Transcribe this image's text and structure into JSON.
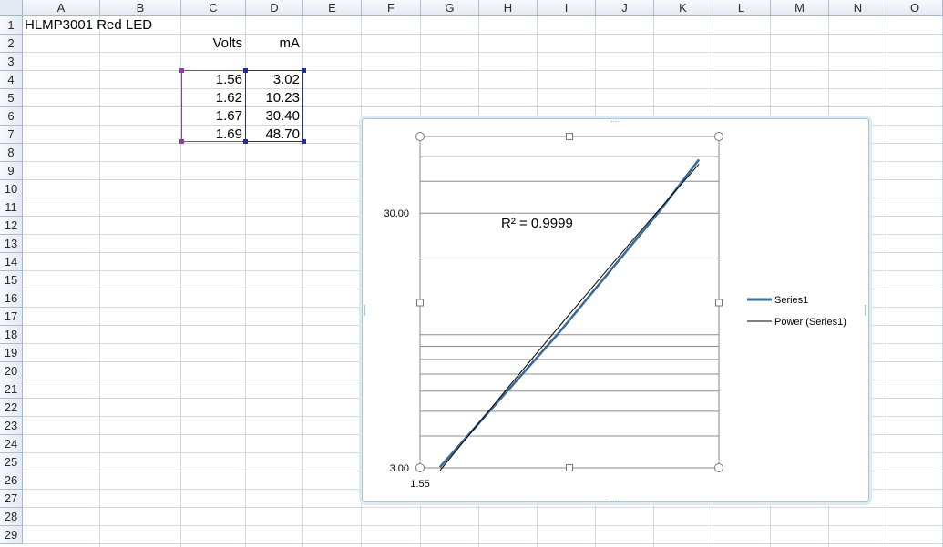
{
  "columns": [
    "A",
    "B",
    "C",
    "D",
    "E",
    "F",
    "G",
    "H",
    "I",
    "J",
    "K",
    "L",
    "M",
    "N",
    "O"
  ],
  "rows": [
    "1",
    "2",
    "3",
    "4",
    "5",
    "6",
    "7",
    "8",
    "9",
    "10",
    "11",
    "12",
    "13",
    "14",
    "15",
    "16",
    "17",
    "18",
    "19",
    "20",
    "21",
    "22",
    "23",
    "24",
    "25",
    "26",
    "27",
    "28",
    "29"
  ],
  "cells": {
    "A1": "HLMP3001 Red LED",
    "C2": "Volts",
    "D2": "mA",
    "C4": "1.56",
    "D4": "3.02",
    "C5": "1.62",
    "D5": "10.23",
    "C6": "1.67",
    "D6": "30.40",
    "C7": "1.69",
    "D7": "48.70"
  },
  "colors": {
    "series_line": "#3a6a9a",
    "trendline": "#000000",
    "range_purple": "#9a36b2",
    "range_blue": "#1c2fa8"
  },
  "chart_data": {
    "type": "scatter",
    "xlim": [
      1.55,
      1.7
    ],
    "ylim": [
      3,
      60
    ],
    "log_y": true,
    "y_tick_labels": [
      "3.00",
      "30.00"
    ],
    "x_tick_labels": [
      "1.55"
    ],
    "series": [
      {
        "name": "Series1",
        "x": [
          1.56,
          1.62,
          1.67,
          1.69
        ],
        "y": [
          3.02,
          10.23,
          30.4,
          48.7
        ]
      }
    ],
    "trendline": {
      "type": "power",
      "name": "Power (Series1)"
    },
    "r_squared_label": "R² = 0.9999",
    "legend": "right",
    "grid": true
  }
}
